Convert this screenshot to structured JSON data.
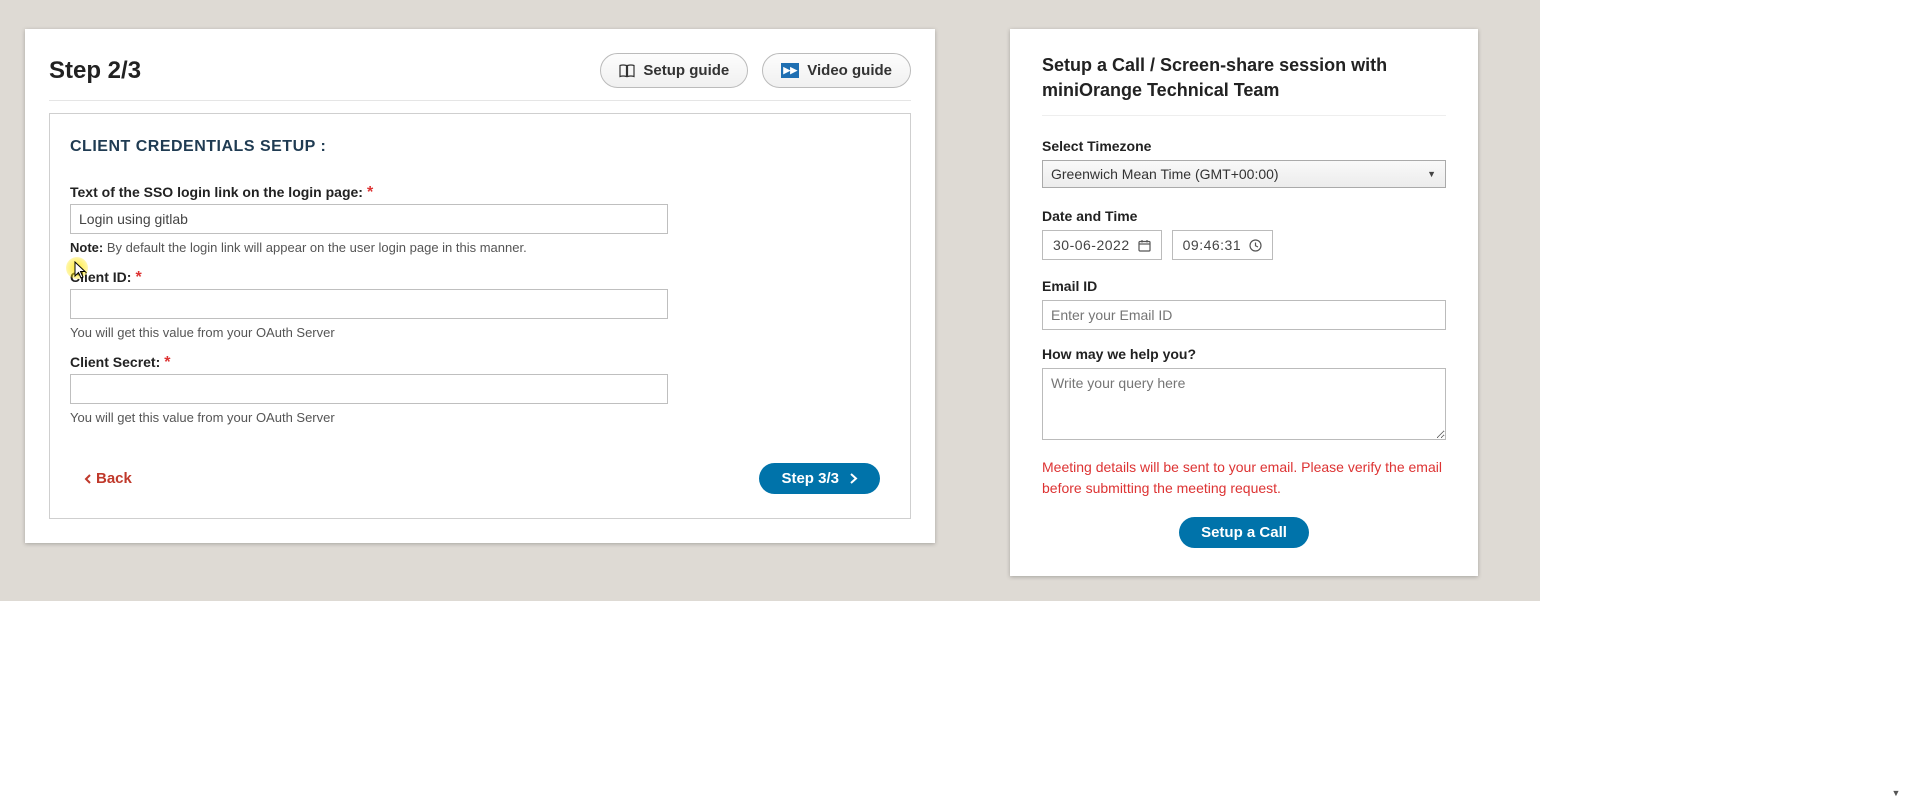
{
  "step": {
    "title": "Step 2/3",
    "guide_buttons": {
      "setup": "Setup guide",
      "video": "Video guide"
    },
    "section_title": "CLIENT CREDENTIALS SETUP :",
    "fields": {
      "sso_text": {
        "label": "Text of the SSO login link on the login page:",
        "value": "Login using gitlab",
        "note_prefix": "Note:",
        "note": " By default the login link will appear on the user login page in this manner."
      },
      "client_id": {
        "label": "Client ID:",
        "help": "You will get this value from your OAuth Server"
      },
      "client_secret": {
        "label": "Client Secret:",
        "help": "You will get this value from your OAuth Server"
      }
    },
    "actions": {
      "back": "Back",
      "next": "Step 3/3"
    }
  },
  "call": {
    "title": "Setup a Call / Screen-share session with miniOrange Technical Team",
    "timezone_label": "Select Timezone",
    "timezone_value": "Greenwich Mean Time (GMT+00:00)",
    "datetime_label": "Date and Time",
    "date_value": "30-06-2022",
    "time_value": "09:46:31",
    "email_label": "Email ID",
    "email_placeholder": "Enter your Email ID",
    "query_label": "How may we help you?",
    "query_placeholder": "Write your query here",
    "warning": "Meeting details will be sent to your email. Please verify the email before submitting the meeting request.",
    "submit": "Setup a Call"
  }
}
